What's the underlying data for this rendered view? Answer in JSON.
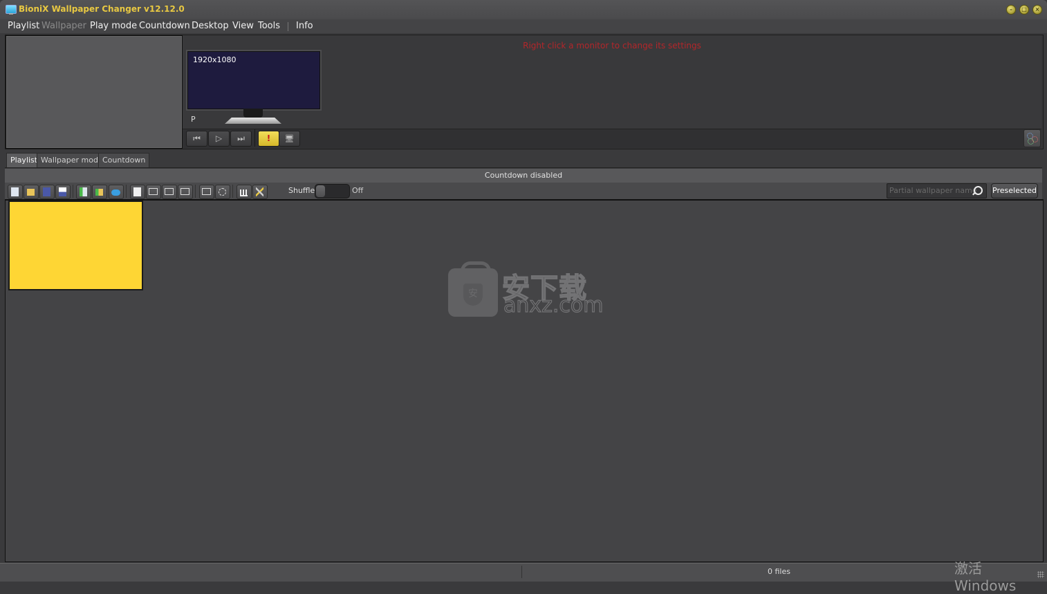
{
  "window": {
    "title": "BioniX Wallpaper Changer  v12.12.0",
    "controls": [
      "minimize",
      "maximize",
      "close"
    ]
  },
  "menu": {
    "items": [
      {
        "label": "Playlist",
        "enabled": true
      },
      {
        "label": "Wallpaper",
        "enabled": false
      },
      {
        "label": "Play mode",
        "enabled": true
      },
      {
        "label": "Countdown",
        "enabled": true
      },
      {
        "label": "Desktop",
        "enabled": true
      },
      {
        "label": "View",
        "enabled": true
      },
      {
        "label": "Tools",
        "enabled": true
      },
      {
        "label": "Info",
        "enabled": true
      }
    ]
  },
  "monitor_panel": {
    "hint": "Right click a monitor to change its settings",
    "monitor": {
      "resolution": "1920x1080",
      "label": "P"
    },
    "controls": {
      "prev_icon": "skip-back-icon",
      "play_icon": "play-icon",
      "next_icon": "skip-forward-icon",
      "warning_icon": "exclamation-icon",
      "desktop_icon": "monitor-icon",
      "settings_icon": "gears-icon"
    },
    "glyphs": {
      "prev": "⏮",
      "play": "▷",
      "next": "⏭",
      "warn": "!",
      "desktop": "🖥"
    }
  },
  "tabs": [
    {
      "label": "Playlist",
      "active": true
    },
    {
      "label": "Wallpaper mode",
      "active": false
    },
    {
      "label": "Countdown",
      "active": false
    }
  ],
  "countdown_status": "Countdown disabled",
  "toolbar": {
    "buttons": [
      "new-playlist-icon",
      "open-folder-icon",
      "save-icon",
      "save-as-icon",
      "import-file-icon",
      "import-folder-icon",
      "cloud-download-icon",
      "blank-page-icon",
      "remove-monitor-icon",
      "remove-monitor-2-icon",
      "remove-monitor-3-icon",
      "remove-display-icon",
      "face-icon",
      "equalizer-icon",
      "tools-icon"
    ],
    "shuffle_label": "Shuffle",
    "shuffle_state": "Off",
    "search_placeholder": "Partial wallpaper name",
    "preselected_label": "Preselected"
  },
  "content": {
    "thumbnail_color": "#fed634"
  },
  "watermark": {
    "cn": "安下载",
    "en": "anxz.com",
    "shield": "安"
  },
  "statusbar": {
    "files": "0 files",
    "activation": "激活 Windows"
  },
  "colors": {
    "title": "#e8c842",
    "hint": "#b3262a",
    "warn_button": "#f2de5a"
  }
}
